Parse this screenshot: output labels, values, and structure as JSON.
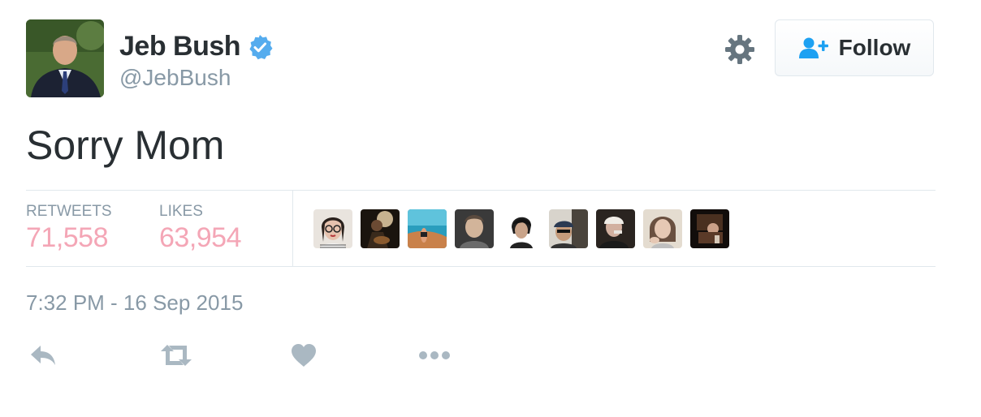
{
  "user": {
    "name": "Jeb Bush",
    "handle": "@JebBush",
    "verified": true,
    "avatar": "profile-photo"
  },
  "header": {
    "settings_icon": "gear-icon",
    "follow_label": "Follow",
    "follow_icon": "person-add-icon"
  },
  "tweet": {
    "text": "Sorry Mom"
  },
  "stats": {
    "retweets_label": "RETWEETS",
    "retweets_count": "71,558",
    "likes_label": "LIKES",
    "likes_count": "63,954"
  },
  "likers": [
    {
      "name": "liker-avatar-1"
    },
    {
      "name": "liker-avatar-2"
    },
    {
      "name": "liker-avatar-3"
    },
    {
      "name": "liker-avatar-4"
    },
    {
      "name": "liker-avatar-5"
    },
    {
      "name": "liker-avatar-6"
    },
    {
      "name": "liker-avatar-7"
    },
    {
      "name": "liker-avatar-8"
    },
    {
      "name": "liker-avatar-9"
    }
  ],
  "timestamp": "7:32 PM - 16 Sep 2015",
  "actions": [
    "reply-icon",
    "retweet-icon",
    "heart-icon",
    "more-icon"
  ],
  "colors": {
    "text": "#292f33",
    "muted": "#8899a6",
    "stat_value": "#f4a6b6",
    "verified": "#55acee",
    "follow_icon": "#1da1f2",
    "action_icon": "#aab8c2",
    "divider": "#e1e8ed"
  }
}
